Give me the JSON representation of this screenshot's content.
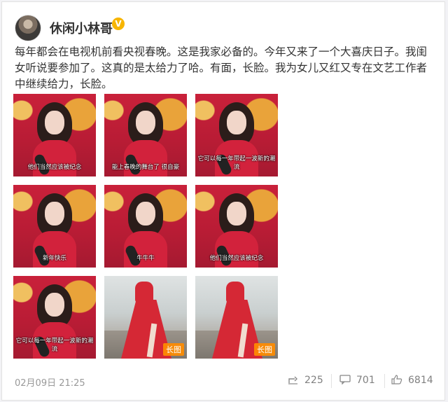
{
  "user": {
    "name": "休闲小林哥"
  },
  "post": {
    "text": "每年都会在电视机前看央视春晚。这是我家必备的。今年又来了一个大喜庆日子。我闺女听说要参加了。这真的是太给力了哈。有面，长脸。我为女儿又红又专在文艺工作者中继续给力，长脸。",
    "images": [
      {
        "caption": "他们当然应该被纪念",
        "type": "red"
      },
      {
        "caption": "能上春晚的舞台了 很自豪",
        "type": "red"
      },
      {
        "caption": "它可以每一年带起一波新的潮流",
        "type": "red"
      },
      {
        "caption": "新年快乐",
        "type": "red"
      },
      {
        "caption": "牛牛牛",
        "type": "red"
      },
      {
        "caption": "他们当然应该被纪念",
        "type": "red"
      },
      {
        "caption": "它可以每一年带起一波新的潮流",
        "type": "red"
      },
      {
        "caption": "",
        "type": "gray",
        "badge": "长图"
      },
      {
        "caption": "",
        "type": "gray",
        "badge": "长图"
      }
    ],
    "time": "02月09日 21:25"
  },
  "actions": {
    "forward": "225",
    "comment": "701",
    "like": "6814"
  },
  "colors": {
    "accent": "#f7b500",
    "text": "#333333",
    "muted": "#999999"
  }
}
